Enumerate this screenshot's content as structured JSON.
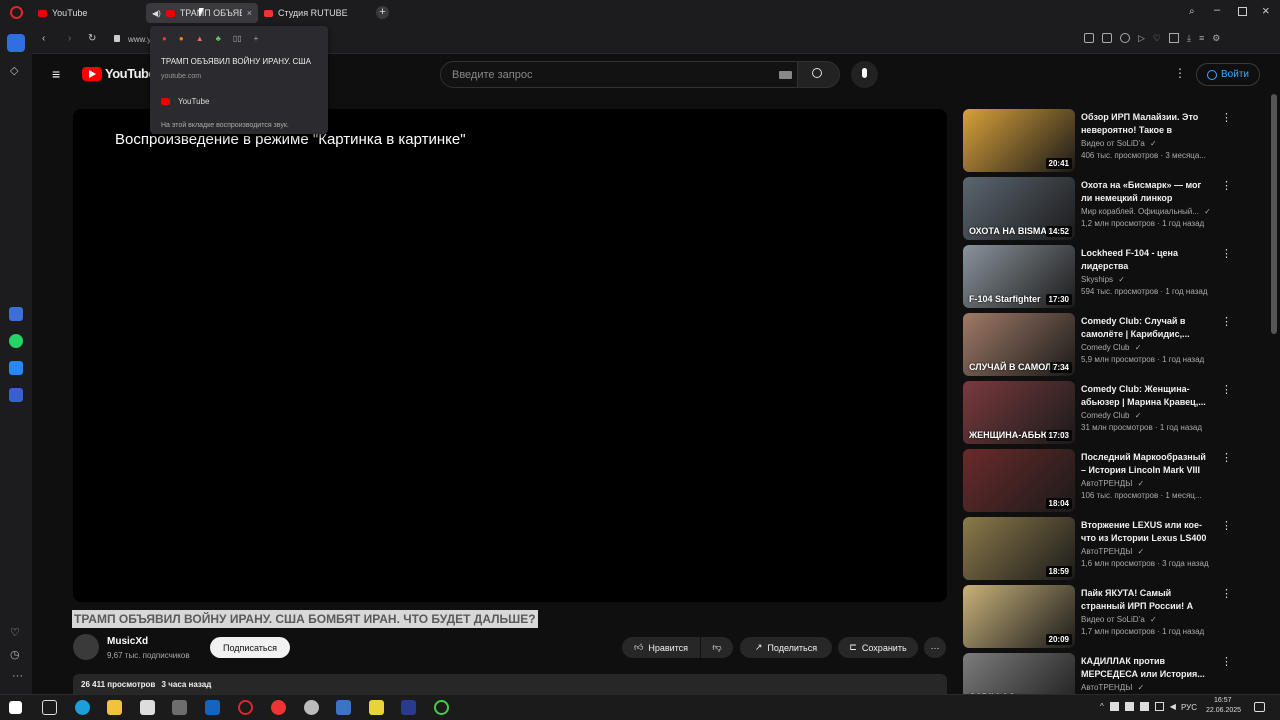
{
  "tabs": [
    {
      "label": "YouTube"
    },
    {
      "label": "ТРАМП ОБЪЯВИЛ"
    },
    {
      "label": "Студия RUTUBE"
    }
  ],
  "tooltip": {
    "title": "ТРАМП ОБЪЯВИЛ ВОЙНУ ИРАНУ. США",
    "domain": "youtube.com",
    "site": "YouTube",
    "audio_note": "На этой вкладке воспроизводится звук."
  },
  "address": {
    "url": "www.youtube.com"
  },
  "header": {
    "logo": "YouTube",
    "search_placeholder": "Введите запрос",
    "login": "Войти"
  },
  "player": {
    "pip_text": "Воспроизведение в режиме \"Картинка в картинке\""
  },
  "video": {
    "title": "ТРАМП ОБЪЯВИЛ ВОЙНУ ИРАНУ. США БОМБЯТ ИРАН. ЧТО БУДЕТ ДАЛЬШЕ?",
    "channel": "MusicXd",
    "subscribers": "9,67 тыс. подписчиков",
    "subscribe": "Подписаться",
    "like": "Нравится",
    "share": "Поделиться",
    "save": "Сохранить",
    "views": "26 411 просмотров",
    "ago": "3 часа назад"
  },
  "recommendations": [
    {
      "title": "Обзор ИРП Малайзии. Это невероятно! Такое в России...",
      "channel": "Видео от SoLiD’а",
      "meta": "406 тыс. просмотров · 3 месяца...",
      "duration": "20:41",
      "thumb_label": "",
      "color": "#d9a13a"
    },
    {
      "title": "Охота на «Бисмарк» — мог ли немецкий линкор спастись?",
      "channel": "Мир кораблей. Официальный...",
      "meta": "1,2 млн просмотров · 1 год назад",
      "duration": "14:52",
      "thumb_label": "ОХОТА НА BISMARCK",
      "color": "#5b6670"
    },
    {
      "title": "Lockheed F-104 - цена лидерства",
      "channel": "Skyships",
      "meta": "594 тыс. просмотров · 1 год назад",
      "duration": "17:30",
      "thumb_label": "F-104 Starfighter",
      "color": "#8a939b"
    },
    {
      "title": "Comedy Club: Случай в самолёте | Карибидис,...",
      "channel": "Comedy Club",
      "meta": "5,9 млн просмотров · 1 год назад",
      "duration": "7:34",
      "thumb_label": "СЛУЧАЙ В САМОЛЁТЕ",
      "color": "#a07a66"
    },
    {
      "title": "Comedy Club: Женщина-абьюзер | Марина Кравец,...",
      "channel": "Comedy Club",
      "meta": "31 млн просмотров · 1 год назад",
      "duration": "17:03",
      "thumb_label": "ЖЕНЩИНА-АБЬЮЗЕР",
      "color": "#7a3a3e"
    },
    {
      "title": "Последний Маркообразный – История Lincoln Mark VIII",
      "channel": "АвтоТРЕНДЫ",
      "meta": "106 тыс. просмотров · 1 месяц...",
      "duration": "18:04",
      "thumb_label": "",
      "color": "#6b2a2a"
    },
    {
      "title": "Вторжение LEXUS или кое-что из Истории Lexus LS400",
      "channel": "АвтоТРЕНДЫ",
      "meta": "1,6 млн просмотров · 3 года назад",
      "duration": "18:59",
      "thumb_label": "",
      "color": "#8b7a4a"
    },
    {
      "title": "Пайк ЯКУТА! Самый странный ИРП России! А так можно...",
      "channel": "Видео от SoLiD’а",
      "meta": "1,7 млн просмотров · 1 год назад",
      "duration": "20:09",
      "thumb_label": "",
      "color": "#c9b27a"
    },
    {
      "title": "КАДИЛЛАК против МЕРСЕДЕСА или История...",
      "channel": "АвтоТРЕНДЫ",
      "meta": "",
      "duration": "",
      "thumb_label": "CADILLAC × MERCEDES",
      "color": "#7c7c7c"
    }
  ],
  "taskbar": {
    "lang": "РУС",
    "time": "16:57",
    "date": "22.06.2025"
  }
}
